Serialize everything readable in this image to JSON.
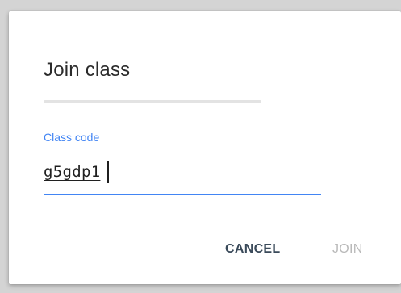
{
  "dialog": {
    "title": "Join class",
    "field": {
      "label": "Class code",
      "value": "g5gdp1"
    },
    "actions": {
      "cancel_label": "CANCEL",
      "join_label": "JOIN",
      "join_enabled": false
    }
  },
  "colors": {
    "accent": "#4285f4",
    "disabled": "#b9b9b9"
  }
}
